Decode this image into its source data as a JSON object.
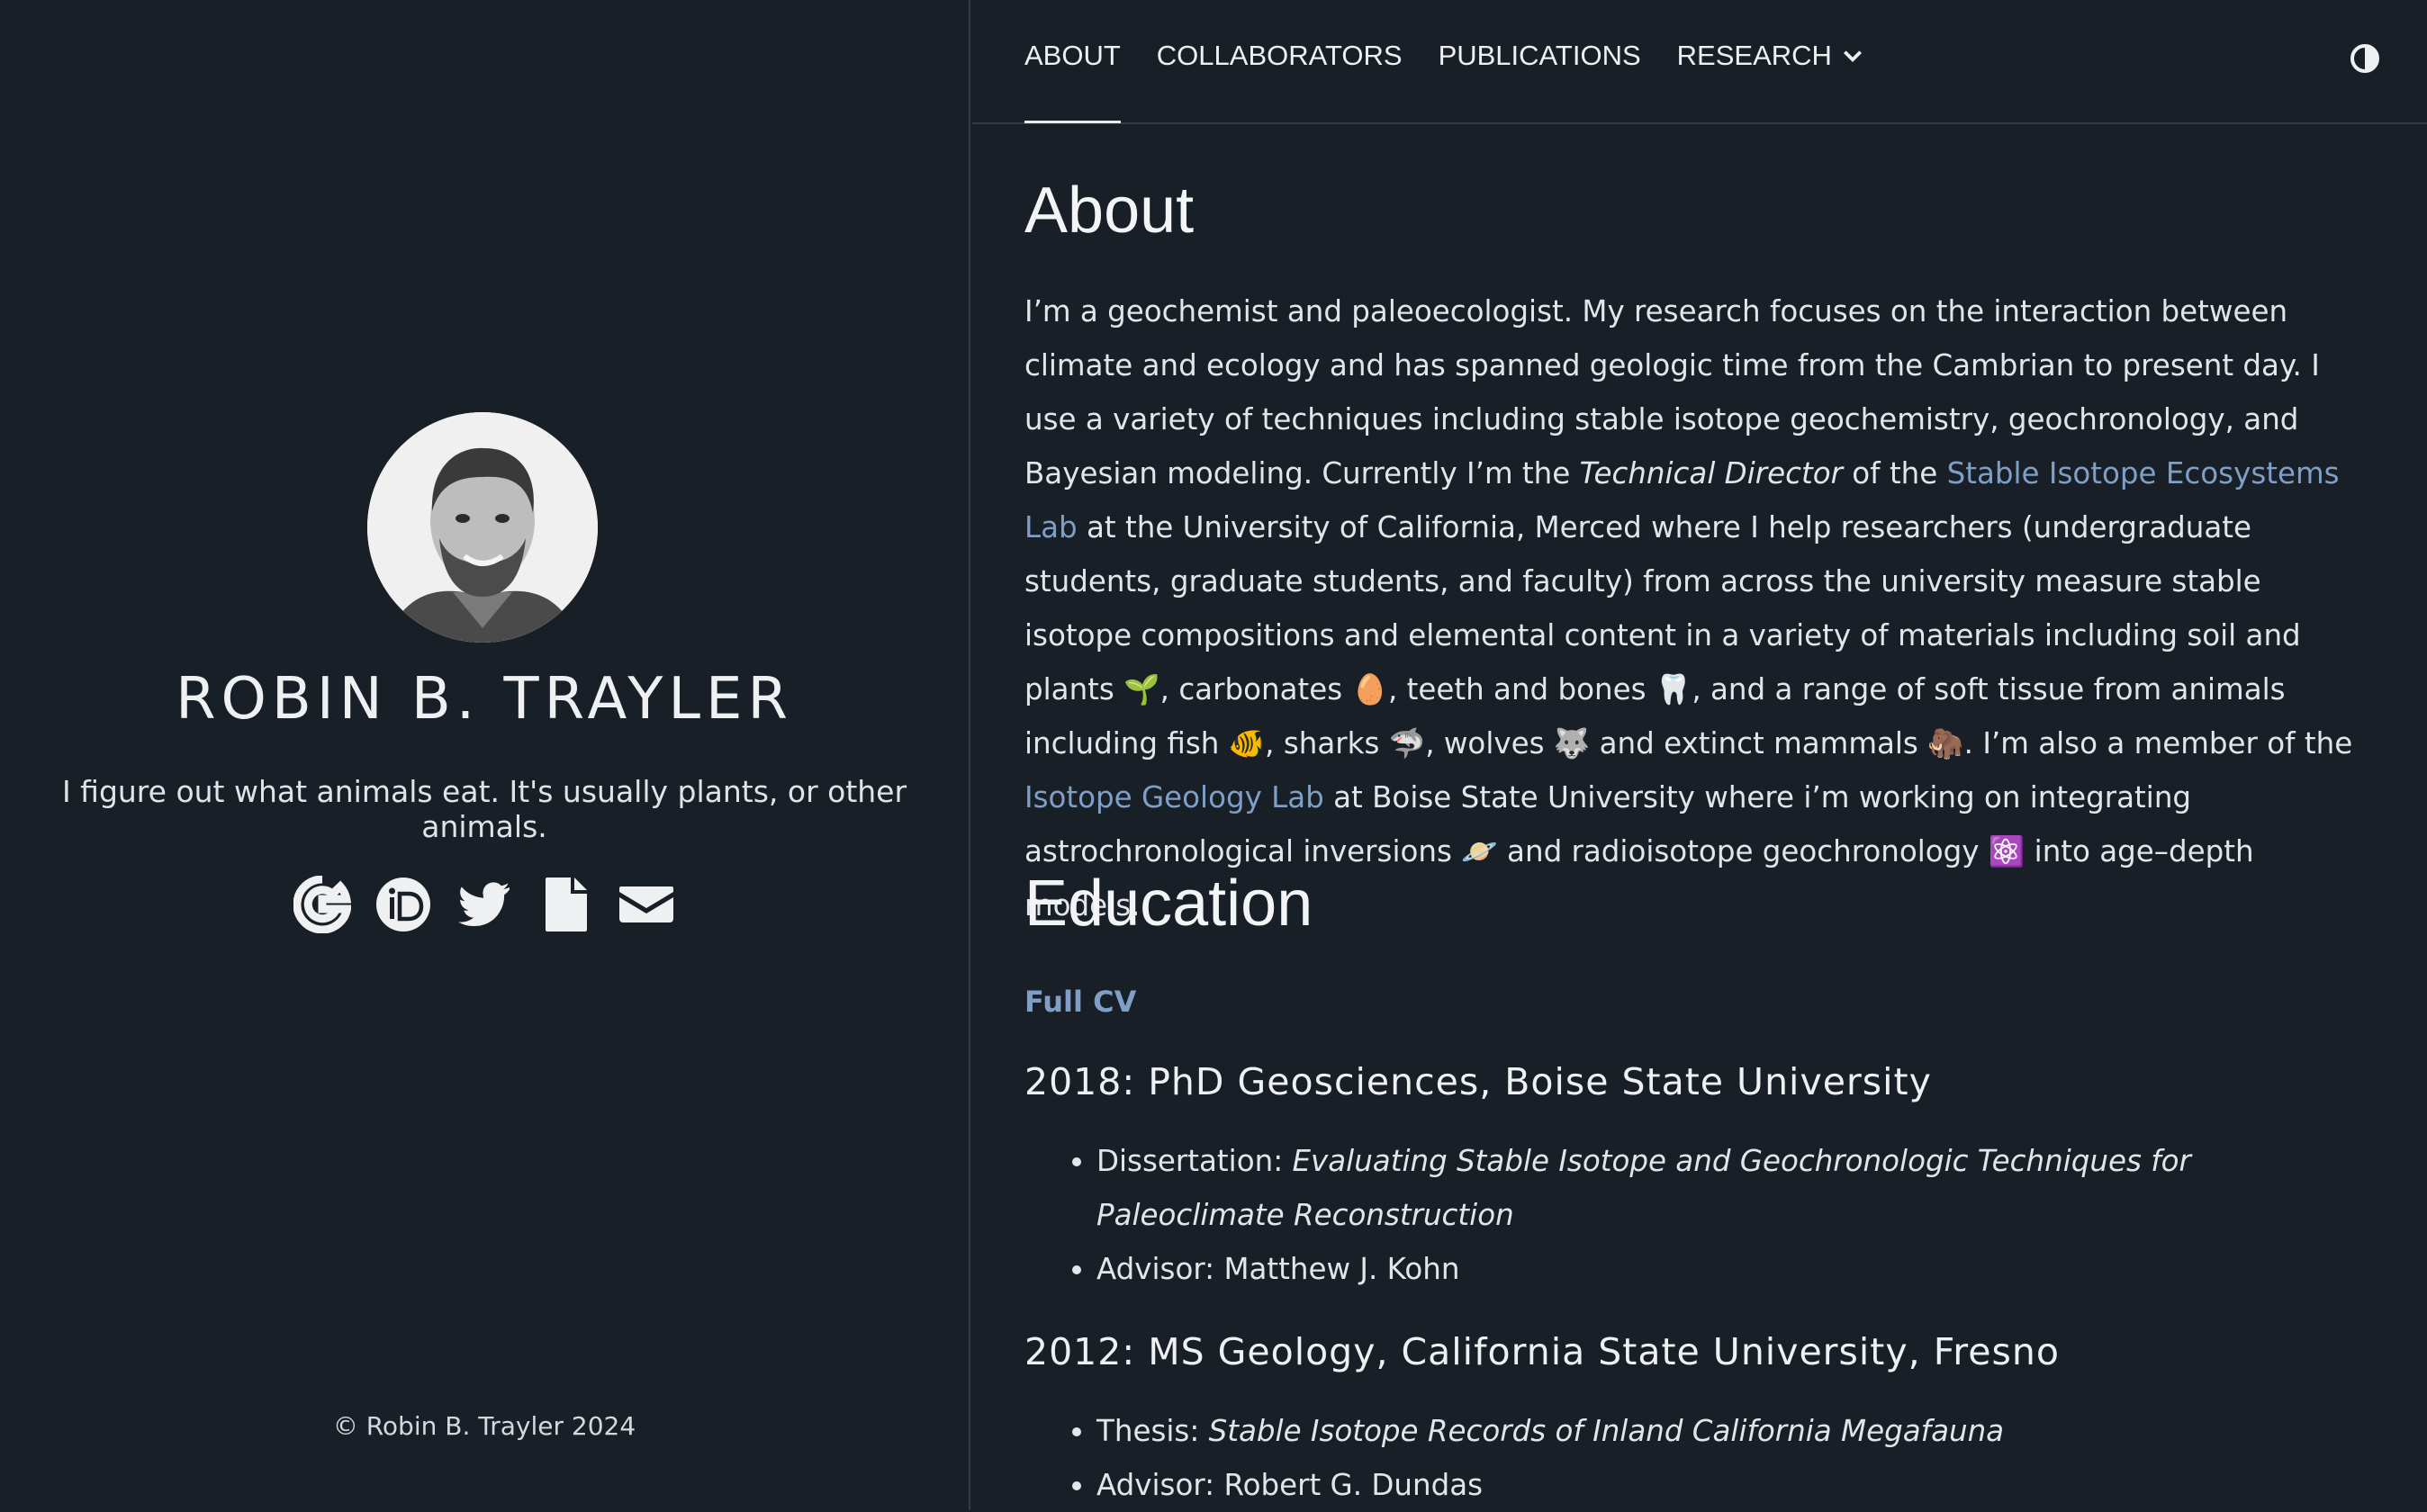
{
  "sidebar": {
    "name": "ROBIN B. TRAYLER",
    "tagline": "I figure out what animals eat. It's usually plants, or other animals.",
    "social_icons": [
      "google-scholar-icon",
      "orcid-icon",
      "twitter-icon",
      "file-icon",
      "envelope-icon"
    ],
    "copyright": "© Robin B. Trayler 2024"
  },
  "nav": {
    "items": [
      "ABOUT",
      "COLLABORATORS",
      "PUBLICATIONS",
      "RESEARCH"
    ],
    "active": "ABOUT",
    "theme_toggle_icon": "contrast-icon"
  },
  "about": {
    "heading": "About",
    "p1": "I’m a geochemist and paleoecologist. My research focuses on the interaction between climate and ecology and has spanned geologic time from the Cambrian to present day. I use a variety of techniques including stable isotope geochemistry, geochronology, and Bayesian modeling. Currently I’m the ",
    "role": "Technical Director",
    "p2": " of the ",
    "lab1": "Stable Isotope Ecosystems Lab",
    "p3": " at the University of California, Merced where I help researchers (undergraduate students, graduate students, and faculty) from across the university measure stable isotope compositions and elemental content in a variety of materials including soil and plants ",
    "e_plant": "🌱",
    "p4": ", carbonates ",
    "e_egg": "🥚",
    "p5": ", teeth and bones ",
    "e_tooth": "🦷",
    "p6": ", and a range of soft tissue from animals including fish ",
    "e_fish": "🐠",
    "p7": ", sharks ",
    "e_shark": "🦈",
    "p8": ", wolves ",
    "e_wolf": "🐺",
    "p9": " and extinct mammals ",
    "e_mammoth": "🦣",
    "p10": ". I’m also a member of the ",
    "lab2": "Isotope Geology Lab",
    "p11": " at Boise State University where i’m working on integrating astrochronological inversions ",
    "e_planet": "🪐",
    "p12": " and radioisotope geochronology ",
    "e_atom": "⚛️",
    "p13": " into age–depth models."
  },
  "education": {
    "heading": "Education",
    "cv_link": "Full CV",
    "degrees": [
      {
        "title": "2018: PhD Geosciences, Boise State University",
        "label1": "Dissertation: ",
        "value1": "Evaluating Stable Isotope and Geochronologic Techniques for Paleoclimate Reconstruction",
        "label2": "Advisor: ",
        "value2": "Matthew J. Kohn"
      },
      {
        "title": "2012: MS Geology, California State University, Fresno",
        "label1": "Thesis: ",
        "value1": "Stable Isotope Records of Inland California Megafauna",
        "label2": "Advisor: ",
        "value2": "Robert G. Dundas"
      }
    ]
  }
}
